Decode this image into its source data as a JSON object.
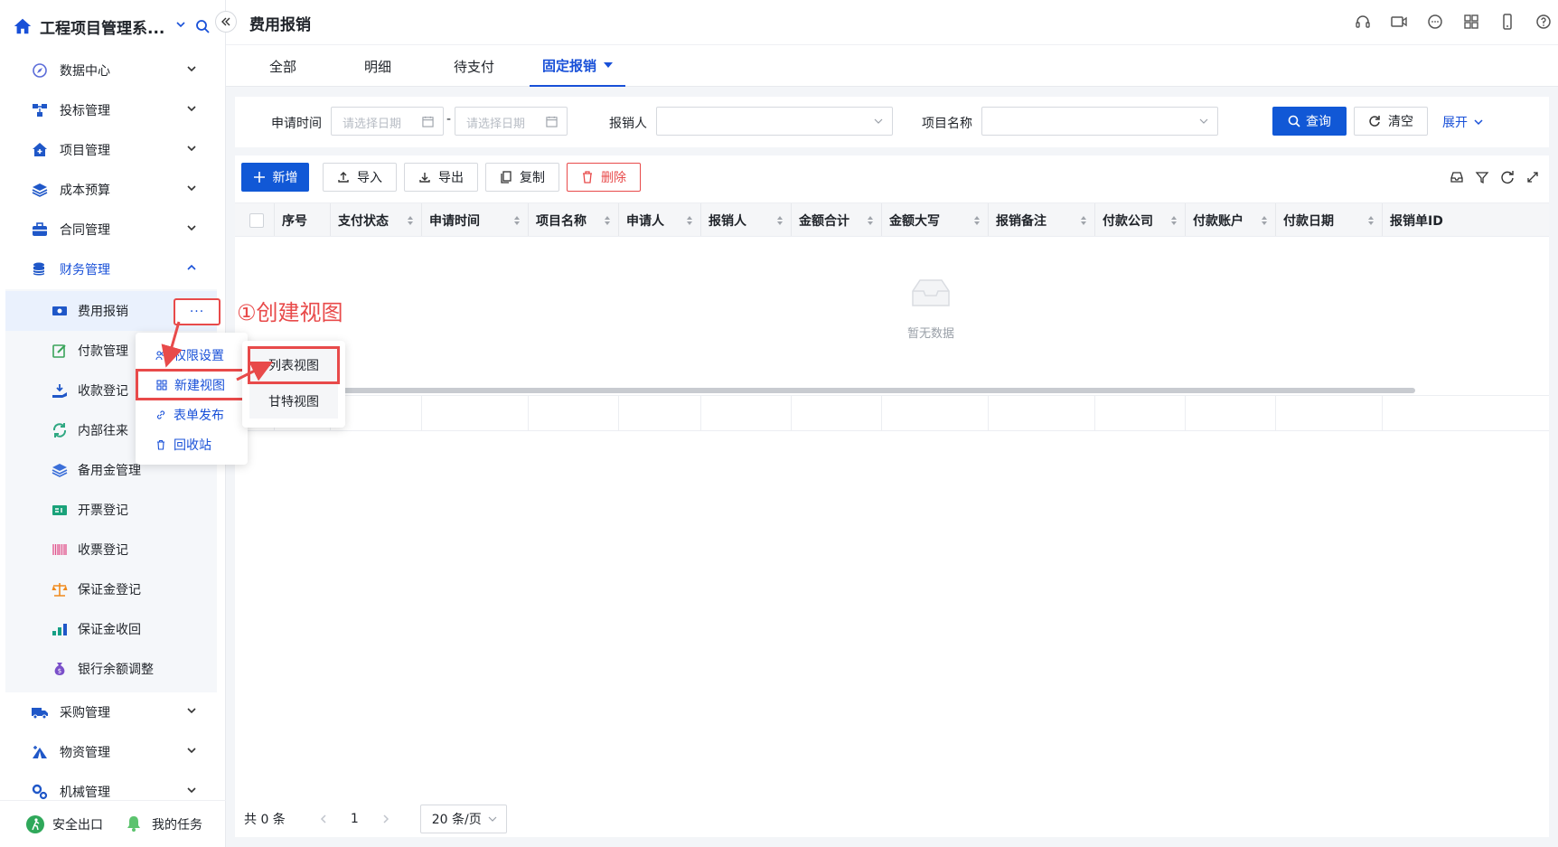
{
  "app": {
    "title": "工程项目管理系..."
  },
  "sidebar": {
    "menu": [
      {
        "label": "数据中心",
        "icon": "compass-icon"
      },
      {
        "label": "投标管理",
        "icon": "flow-icon"
      },
      {
        "label": "项目管理",
        "icon": "house-plus-icon"
      },
      {
        "label": "成本预算",
        "icon": "layers-icon"
      },
      {
        "label": "合同管理",
        "icon": "briefcase-icon"
      },
      {
        "label": "财务管理",
        "icon": "coins-icon"
      }
    ],
    "finance_sub": [
      {
        "label": "费用报销",
        "icon": "money-icon"
      },
      {
        "label": "付款管理",
        "icon": "edit-icon"
      },
      {
        "label": "收款登记",
        "icon": "hand-money-icon"
      },
      {
        "label": "内部往来",
        "icon": "refresh-icon"
      },
      {
        "label": "备用金管理",
        "icon": "stack-icon"
      },
      {
        "label": "开票登记",
        "icon": "invoice-icon"
      },
      {
        "label": "收票登记",
        "icon": "barcode-icon"
      },
      {
        "label": "保证金登记",
        "icon": "scale-icon"
      },
      {
        "label": "保证金收回",
        "icon": "bars-icon"
      },
      {
        "label": "银行余额调整",
        "icon": "money-bag-icon"
      }
    ],
    "menu_after": [
      {
        "label": "采购管理",
        "icon": "truck-icon"
      },
      {
        "label": "物资管理",
        "icon": "tent-icon"
      },
      {
        "label": "机械管理",
        "icon": "gears-icon"
      }
    ],
    "more_label": "···",
    "bottom": {
      "exit_label": "安全出口",
      "tasks_label": "我的任务"
    }
  },
  "context_menu": {
    "items": [
      "权限设置",
      "新建视图",
      "表单发布",
      "回收站"
    ],
    "submenu": [
      "列表视图",
      "甘特视图"
    ]
  },
  "annotation": "①创建视图",
  "header": {
    "page_title": "费用报销"
  },
  "tabs": [
    "全部",
    "明细",
    "待支付",
    "固定报销"
  ],
  "filter": {
    "date_label": "申请时间",
    "date_placeholder": "请选择日期",
    "dash": "-",
    "reporter_label": "报销人",
    "project_label": "项目名称",
    "query_label": "查询",
    "clear_label": "清空",
    "expand_label": "展开"
  },
  "toolbar": {
    "add_label": "新增",
    "import_label": "导入",
    "export_label": "导出",
    "copy_label": "复制",
    "delete_label": "删除"
  },
  "table": {
    "columns": [
      "序号",
      "支付状态",
      "申请时间",
      "项目名称",
      "申请人",
      "报销人",
      "金额合计",
      "金额大写",
      "报销备注",
      "付款公司",
      "付款账户",
      "付款日期",
      "报销单ID"
    ],
    "empty_text": "暂无数据"
  },
  "pagination": {
    "total": "共 0 条",
    "page": "1",
    "page_size": "20 条/页"
  },
  "colors": {
    "primary": "#1158d6",
    "danger": "#e84a4a"
  }
}
